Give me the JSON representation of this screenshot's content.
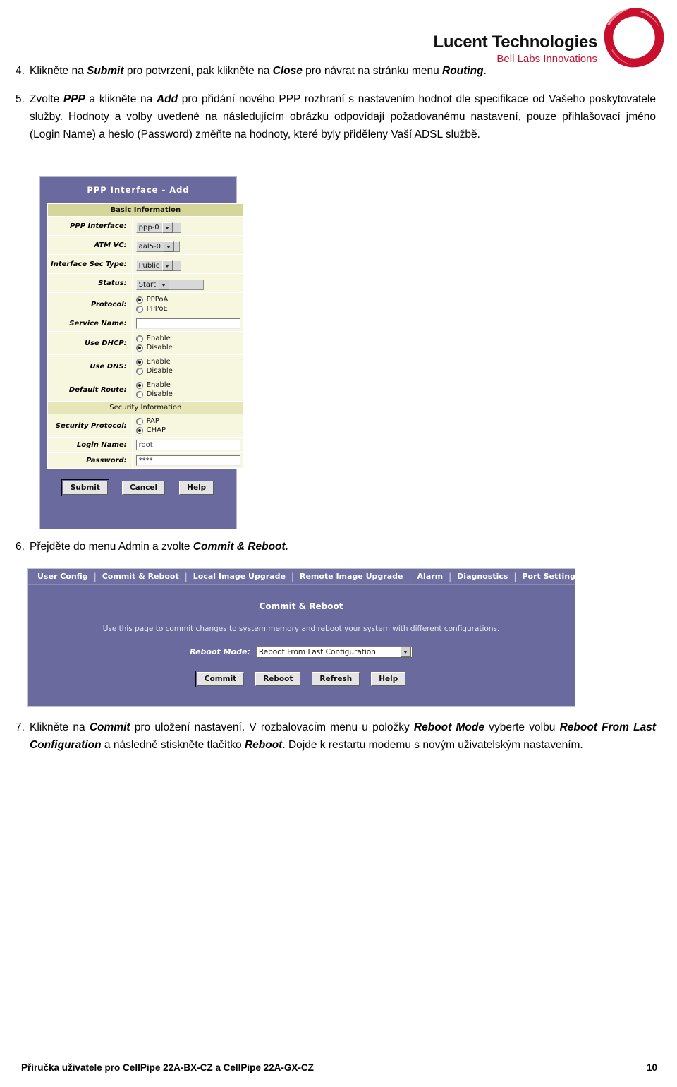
{
  "brand": {
    "name": "Lucent Technologies",
    "tagline": "Bell Labs Innovations",
    "ring_color": "#c8102e",
    "logo_icon": "lucent-ring-icon"
  },
  "steps": [
    {
      "number": "4.",
      "parts": [
        {
          "t": "Klikněte na ",
          "b": false
        },
        {
          "t": "Submit",
          "b": true
        },
        {
          "t": " pro potvrzení, pak klikněte na ",
          "b": false
        },
        {
          "t": "Close",
          "b": true
        },
        {
          "t": " pro návrat na stránku menu ",
          "b": false
        },
        {
          "t": "Routing",
          "b": true
        },
        {
          "t": ".",
          "b": false
        }
      ]
    },
    {
      "number": "5.",
      "parts": [
        {
          "t": "Zvolte ",
          "b": false
        },
        {
          "t": "PPP",
          "b": true
        },
        {
          "t": " a klikněte na ",
          "b": false
        },
        {
          "t": "Add",
          "b": true
        },
        {
          "t": " pro přidání nového PPP rozhraní s nastavením hodnot dle specifikace od Vašeho poskytovatele služby. Hodnoty a volby uvedené na následujícím obrázku odpovídají požadovanému nastavení, pouze přihlašovací jméno (Login Name) a heslo (Password) změňte na hodnoty, které byly přiděleny Vaší ADSL službě.",
          "b": false
        }
      ]
    },
    {
      "number": "6.",
      "parts": [
        {
          "t": "Přejděte do menu Admin a zvolte ",
          "b": false
        },
        {
          "t": "Commit & Reboot.",
          "b": true
        }
      ]
    },
    {
      "number": "7.",
      "parts": [
        {
          "t": "Klikněte na ",
          "b": false
        },
        {
          "t": "Commit",
          "b": true
        },
        {
          "t": " pro uložení nastavení. V rozbalovacím menu u položky ",
          "b": false
        },
        {
          "t": "Reboot Mode",
          "b": true
        },
        {
          "t": " vyberte volbu ",
          "b": false
        },
        {
          "t": "Reboot From Last Configuration",
          "b": true
        },
        {
          "t": " a následně stiskněte tlačítko ",
          "b": false
        },
        {
          "t": "Reboot",
          "b": true
        },
        {
          "t": ". Dojde k restartu modemu s novým uživatelským nastavením.",
          "b": false
        }
      ]
    }
  ],
  "ppp_form": {
    "title": "PPP Interface - Add",
    "bg_color": "#6a6a9e",
    "section_basic": "Basic Information",
    "section_security": "Security Information",
    "rows": {
      "ppp_interface_label": "PPP Interface:",
      "ppp_interface_value": "ppp-0",
      "atm_vc_label": "ATM VC:",
      "atm_vc_value": "aal5-0",
      "sec_type_label": "Interface Sec Type:",
      "sec_type_value": "Public",
      "status_label": "Status:",
      "status_value": "Start",
      "protocol_label": "Protocol:",
      "protocol_opt1": "PPPoA",
      "protocol_opt2": "PPPoE",
      "service_name_label": "Service Name:",
      "service_name_value": "",
      "use_dhcp_label": "Use DHCP:",
      "use_dns_label": "Use DNS:",
      "default_route_label": "Default Route:",
      "enable": "Enable",
      "disable": "Disable",
      "security_protocol_label": "Security Protocol:",
      "sec_opt1": "PAP",
      "sec_opt2": "CHAP",
      "login_name_label": "Login Name:",
      "login_name_value": "root",
      "password_label": "Password:",
      "password_value": "****"
    },
    "buttons": {
      "submit": "Submit",
      "cancel": "Cancel",
      "help": "Help"
    }
  },
  "commit_reboot": {
    "tabs": [
      "User Config",
      "Commit & Reboot",
      "Local Image Upgrade",
      "Remote Image Upgrade",
      "Alarm",
      "Diagnostics",
      "Port Settings"
    ],
    "page_title": "Commit & Reboot",
    "description": "Use this page to commit changes to system memory and reboot your system with different configurations.",
    "reboot_mode_label": "Reboot Mode:",
    "reboot_mode_value": "Reboot From Last Configuration",
    "buttons": {
      "commit": "Commit",
      "reboot": "Reboot",
      "refresh": "Refresh",
      "help": "Help"
    }
  },
  "footer": {
    "text": "Příručka uživatele pro CellPipe 22A-BX-CZ a CellPipe 22A-GX-CZ",
    "page_number": "10"
  }
}
